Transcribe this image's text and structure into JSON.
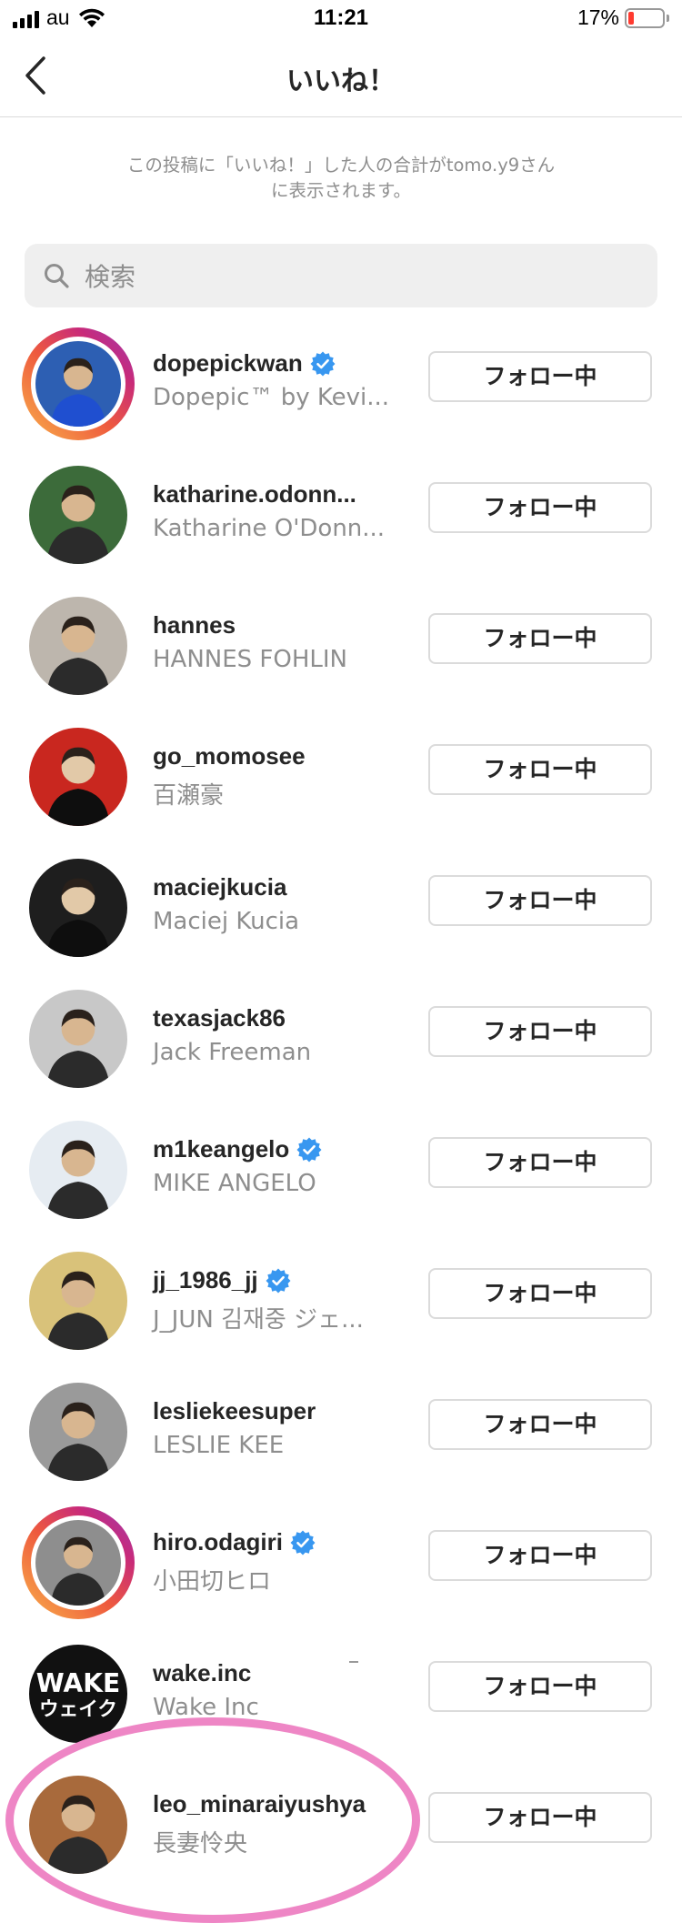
{
  "status_bar": {
    "carrier": "au",
    "time": "11:21",
    "battery": "17%",
    "battery_level": 0.17,
    "battery_color": "#ff3b30"
  },
  "header": {
    "back_icon": "chevron-left-icon",
    "title": "いいね！"
  },
  "notice": {
    "line1": "この投稿に「いいね！」した人の合計がtomo.y9さん",
    "line2": "に表示されます。"
  },
  "search": {
    "icon": "search-icon",
    "placeholder": "検索",
    "value": ""
  },
  "users": [
    {
      "username": "dopepickwan",
      "fullname": "Dopepic™ by Kevi...",
      "verified": true,
      "story": true,
      "button": "フォロー中",
      "avatar_bg": "#2d5fb3"
    },
    {
      "username": "katharine.odonn...",
      "fullname": "Katharine O'Donn...",
      "verified": false,
      "story": false,
      "button": "フォロー中",
      "avatar_bg": "#3c6b3a"
    },
    {
      "username": "hannes",
      "fullname": "HANNES FOHLIN",
      "verified": false,
      "story": false,
      "button": "フォロー中",
      "avatar_bg": "#bdb6ad"
    },
    {
      "username": "go_momosee",
      "fullname": "百瀬豪",
      "verified": false,
      "story": false,
      "button": "フォロー中",
      "avatar_bg": "#c9271f"
    },
    {
      "username": "maciejkucia",
      "fullname": "Maciej Kucia",
      "verified": false,
      "story": false,
      "button": "フォロー中",
      "avatar_bg": "#1e1e1e"
    },
    {
      "username": "texasjack86",
      "fullname": "Jack Freeman",
      "verified": false,
      "story": false,
      "button": "フォロー中",
      "avatar_bg": "#c8c8c8"
    },
    {
      "username": "m1keangelo",
      "fullname": "MIKE ANGELO",
      "verified": true,
      "story": false,
      "button": "フォロー中",
      "avatar_bg": "#e6ecf2"
    },
    {
      "username": "jj_1986_jj",
      "fullname": "J_JUN 김재중 ジェ...",
      "verified": true,
      "story": false,
      "button": "フォロー中",
      "avatar_bg": "#d9c27a"
    },
    {
      "username": "lesliekeesuper",
      "fullname": "LESLIE KEE",
      "verified": false,
      "story": false,
      "button": "フォロー中",
      "avatar_bg": "#9a9a9a"
    },
    {
      "username": "hiro.odagiri",
      "fullname": "小田切ヒロ",
      "verified": true,
      "story": true,
      "button": "フォロー中",
      "avatar_bg": "#8e8e8e"
    },
    {
      "username": "wake.inc",
      "fullname": "Wake Inc",
      "verified": false,
      "story": false,
      "button": "フォロー中",
      "avatar_bg": "#111111",
      "logo_text": "WAKE",
      "logo_sub": "ウェイク"
    },
    {
      "username": "leo_minaraiyushya",
      "fullname": "長妻怜央",
      "verified": false,
      "story": false,
      "button": "フォロー中",
      "avatar_bg": "#a86a3c"
    }
  ],
  "colors": {
    "highlight": "#ee86c5",
    "verified": "#3897f0",
    "text_primary": "#262626",
    "text_secondary": "#8e8e8e",
    "border": "#dbdbdb"
  }
}
